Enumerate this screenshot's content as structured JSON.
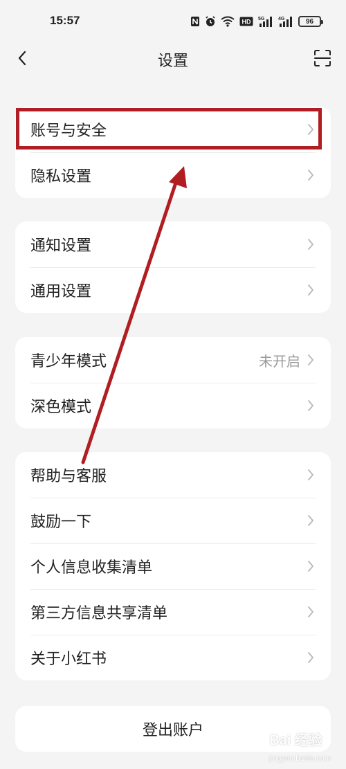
{
  "status_bar": {
    "time": "15:57",
    "battery": "96",
    "network_5g": "5G",
    "network_4g": "4G",
    "hd_badge": "HD"
  },
  "header": {
    "title": "设置"
  },
  "groups": [
    {
      "items": [
        {
          "label": "账号与安全"
        },
        {
          "label": "隐私设置"
        }
      ]
    },
    {
      "items": [
        {
          "label": "通知设置"
        },
        {
          "label": "通用设置"
        }
      ]
    },
    {
      "items": [
        {
          "label": "青少年模式",
          "value": "未开启"
        },
        {
          "label": "深色模式"
        }
      ]
    },
    {
      "items": [
        {
          "label": "帮助与客服"
        },
        {
          "label": "鼓励一下"
        },
        {
          "label": "个人信息收集清单"
        },
        {
          "label": "第三方信息共享清单"
        },
        {
          "label": "关于小红书"
        }
      ]
    }
  ],
  "logout_label": "登出账户",
  "watermark": {
    "text": "Bai  经验",
    "sub": "jingyan.baidu.com"
  },
  "colors": {
    "annotation": "#b01e23",
    "background": "#f4f4f4",
    "card": "#ffffff"
  }
}
